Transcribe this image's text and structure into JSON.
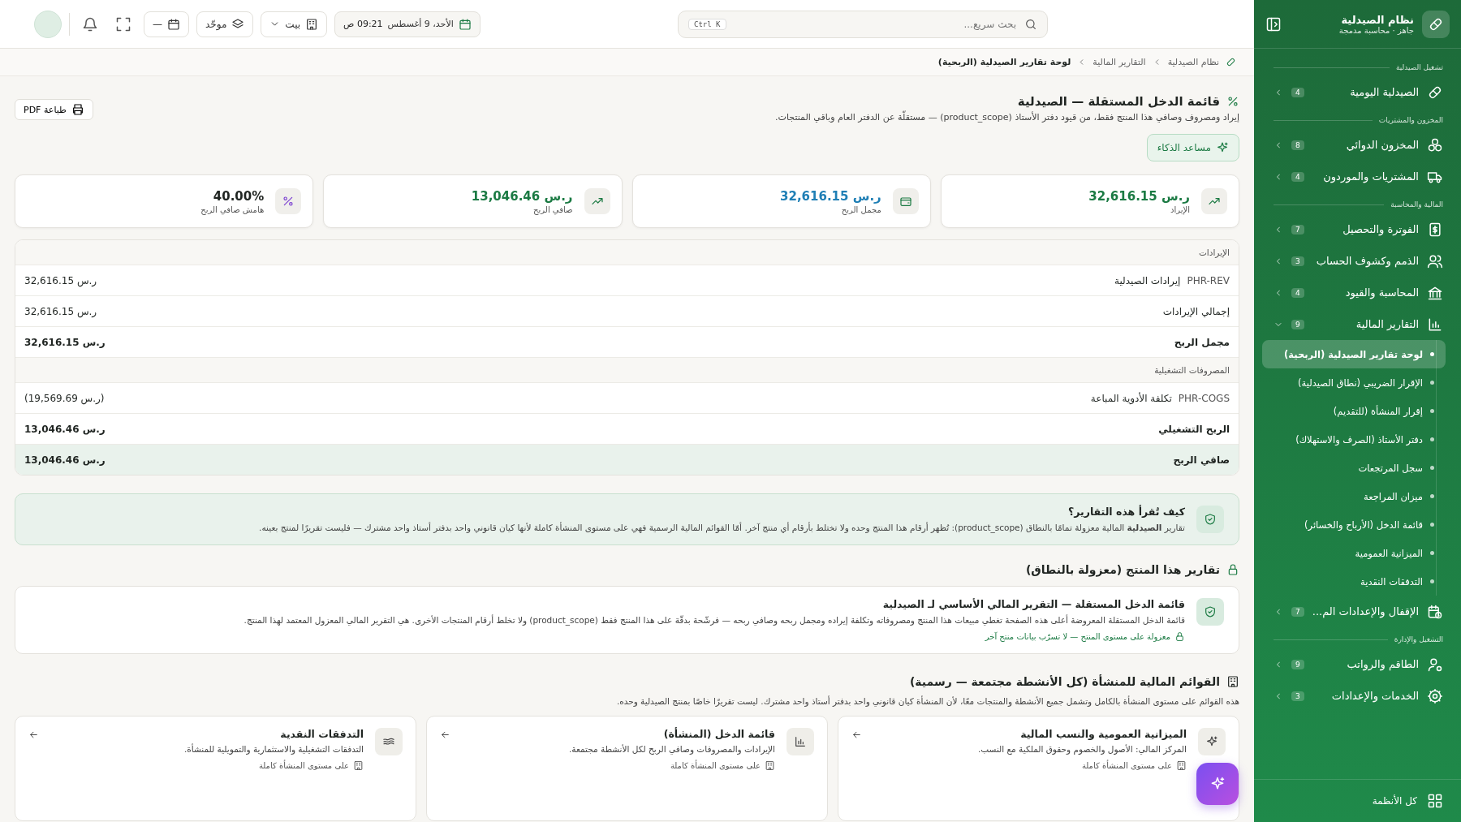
{
  "sidebar": {
    "title": "نظام الصيدلية",
    "subtitle": "جاهز · محاسبة مدمجة",
    "sections": [
      {
        "heading": "تشغيل الصيدلية",
        "items": [
          {
            "label": "الصيدلية اليومية",
            "count": "4",
            "expanded": false
          }
        ]
      },
      {
        "heading": "المخزون والمشتريات",
        "items": [
          {
            "label": "المخزون الدوائي",
            "count": "8",
            "expanded": false
          },
          {
            "label": "المشتريات والموردون",
            "count": "4",
            "expanded": false
          }
        ]
      },
      {
        "heading": "المالية والمحاسبة",
        "items": [
          {
            "label": "الفوترة والتحصيل",
            "count": "7",
            "expanded": false
          },
          {
            "label": "الذمم وكشوف الحساب",
            "count": "3",
            "expanded": false
          },
          {
            "label": "المحاسبة والقيود",
            "count": "4",
            "expanded": false
          },
          {
            "label": "التقارير المالية",
            "count": "9",
            "expanded": true,
            "children": [
              {
                "label": "لوحة تقارير الصيدلية (الربحية)",
                "selected": true
              },
              {
                "label": "الإقرار الضريبي (نطاق الصيدلية)",
                "selected": false
              },
              {
                "label": "إقرار المنشأة (للتقديم)",
                "selected": false
              },
              {
                "label": "دفتر الأستاذ (الصرف والاستهلاك)",
                "selected": false
              },
              {
                "label": "سجل المرتجعات",
                "selected": false
              },
              {
                "label": "ميزان المراجعة",
                "selected": false
              },
              {
                "label": "قائمة الدخل (الأرباح والخسائر)",
                "selected": false
              },
              {
                "label": "الميزانية العمومية",
                "selected": false
              },
              {
                "label": "التدفقات النقدية",
                "selected": false
              }
            ]
          },
          {
            "label": "الإقفال والإعدادات الم...",
            "count": "7",
            "expanded": false
          }
        ]
      },
      {
        "heading": "التشغيل والإدارة",
        "items": [
          {
            "label": "الطاقم والرواتب",
            "count": "9",
            "expanded": false
          },
          {
            "label": "الخدمات والإعدادات",
            "count": "3",
            "expanded": false
          }
        ]
      }
    ],
    "footer": "كل الأنظمة"
  },
  "topbar": {
    "search": {
      "placeholder": "بحث سريع...",
      "shortcut": "Ctrl K"
    },
    "date": "الأحد، 9 أغسطس",
    "time": "09:21 ص",
    "branch": "بيت",
    "mode": "موحّد",
    "period": "—"
  },
  "breadcrumb": [
    "نظام الصيدلية",
    "التقارير المالية",
    "لوحة تقارير الصيدلية (الربحية)"
  ],
  "page": {
    "title": "قائمة الدخل المستقلة — الصيدلية",
    "subtitle": "إيراد ومصروف وصافي هذا المنتج فقط، من قيود دفتر الأستاذ (product_scope) — مستقلّة عن الدفتر العام وباقي المنتجات.",
    "print": "طباعة PDF",
    "assistant": "مساعد الذكاء"
  },
  "kpis": [
    {
      "value": "ر.س 32,616.15",
      "label": "الإيراد",
      "color": "#1b7a43"
    },
    {
      "value": "ر.س 32,616.15",
      "label": "مجمل الربح",
      "color": "#1f7fb5"
    },
    {
      "value": "ر.س 13,046.46",
      "label": "صافي الربح",
      "color": "#1b7a43"
    },
    {
      "value": "40.00%",
      "label": "هامش صافي الربح",
      "color": "#1f2421"
    }
  ],
  "statement": [
    {
      "kind": "section",
      "label": "الإيرادات"
    },
    {
      "kind": "line",
      "code": "PHR-REV",
      "label": "إيرادات الصيدلية",
      "amount": "ر.س 32,616.15"
    },
    {
      "kind": "line",
      "label": "إجمالي الإيرادات",
      "amount": "ر.س 32,616.15"
    },
    {
      "kind": "total",
      "label": "مجمل الربح",
      "amount": "ر.س 32,616.15"
    },
    {
      "kind": "section",
      "label": "المصروفات التشغيلية"
    },
    {
      "kind": "line",
      "code": "PHR-COGS",
      "label": "تكلفة الأدوية المباعة",
      "amount": "(ر.س 19,569.69)"
    },
    {
      "kind": "total",
      "label": "الربح التشغيلي",
      "amount": "ر.س 13,046.46"
    },
    {
      "kind": "final",
      "label": "صافي الربح",
      "amount": "ر.س 13,046.46"
    }
  ],
  "note": {
    "title": "كيف تُقرأ هذه التقارير؟",
    "text": "تقارير **الصيدلية** المالية معزولة تمامًا بالنطاق (product_scope): تُظهر أرقام هذا المنتج وحده ولا تختلط بأرقام أي منتج آخر. أمّا القوائم المالية الرسمية فهي على مستوى المنشأة كاملة لأنها كيان قانوني واحد بدفتر أستاذ واحد مشترك — فليست تقريرًا لمنتج بعينه."
  },
  "product_reports": {
    "heading": "تقارير هذا المنتج (معزولة بالنطاق)",
    "card": {
      "title": "قائمة الدخل المستقلة — التقرير المالي الأساسي لـ الصيدلية",
      "text": "قائمة الدخل المستقلة المعروضة أعلى هذه الصفحة تغطي مبيعات هذا المنتج ومصروفاته وتكلفة إيراده ومجمل ربحه وصافي ربحه — فرشّحة بدقّة على هذا المنتج فقط (product_scope) ولا تخلط أرقام المنتجات الأخرى. هي التقرير المالي المعزول المعتمد لهذا المنتج.",
      "tag": "معزولة على مستوى المنتج — لا تسرّب بيانات منتج آخر"
    }
  },
  "entity_statements": {
    "heading": "القوائم المالية للمنشأة (كل الأنشطة مجتمعة — رسمية)",
    "description": "هذه القوائم على مستوى المنشأة بالكامل وتشمل جميع الأنشطة والمنتجات معًا، لأن المنشأة كيان قانوني واحد بدفتر أستاذ واحد مشترك. ليست تقريرًا خاصًا بمنتج الصيدلية وحده.",
    "cards": [
      {
        "title": "الميزانية العمومية والنسب المالية",
        "text": "المركز المالي: الأصول والخصوم وحقوق الملكية مع النسب.",
        "scope": "على مستوى المنشأة كاملة"
      },
      {
        "title": "قائمة الدخل (المنشأة)",
        "text": "الإيرادات والمصروفات وصافي الربح لكل الأنشطة مجتمعة.",
        "scope": "على مستوى المنشأة كاملة"
      },
      {
        "title": "التدفقات النقدية",
        "text": "التدفقات التشغيلية والاستثمارية والتمويلية للمنشأة.",
        "scope": "على مستوى المنشأة كاملة"
      }
    ]
  }
}
